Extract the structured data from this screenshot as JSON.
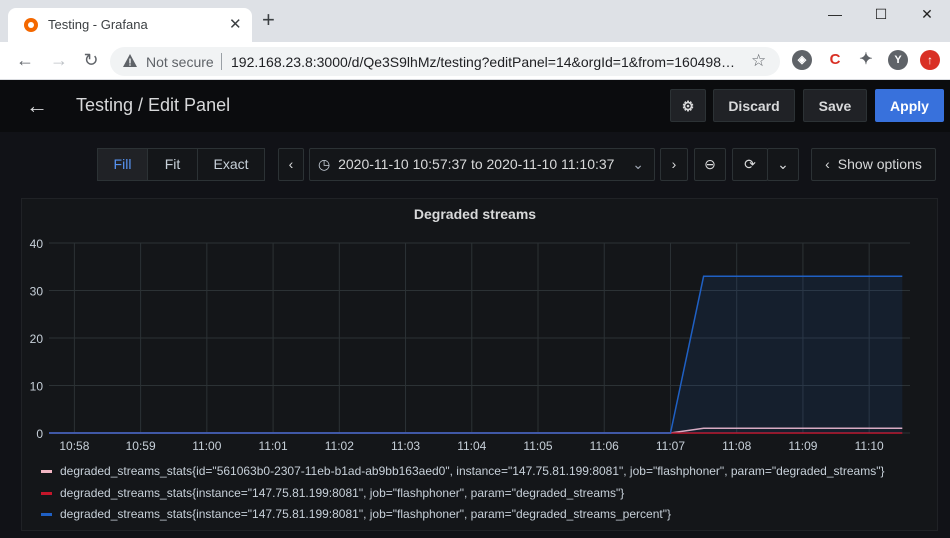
{
  "browser": {
    "tab_title": "Testing - Grafana",
    "security_label": "Not secure",
    "url": "192.168.23.8:3000/d/Qe3S9lhMz/testing?editPanel=14&orgId=1&from=160498…",
    "profile_initial": "Y"
  },
  "header": {
    "title": "Testing / Edit Panel",
    "discard_label": "Discard",
    "save_label": "Save",
    "apply_label": "Apply"
  },
  "toolbar": {
    "fill_label": "Fill",
    "fit_label": "Fit",
    "exact_label": "Exact",
    "time_range": "2020-11-10 10:57:37 to 2020-11-10 11:10:37",
    "show_options_label": "Show options"
  },
  "panel": {
    "title": "Degraded streams"
  },
  "chart_data": {
    "type": "line",
    "title": "Degraded streams",
    "x_ticks": [
      "10:58",
      "10:59",
      "11:00",
      "11:01",
      "11:02",
      "11:03",
      "11:04",
      "11:05",
      "11:06",
      "11:07",
      "11:08",
      "11:09",
      "11:10"
    ],
    "y_ticks": [
      0,
      10,
      20,
      30,
      40
    ],
    "ylim": [
      0,
      40
    ],
    "xlim": [
      "10:57:37",
      "11:10:37"
    ],
    "grid": true,
    "legend_placement": "bottom",
    "series": [
      {
        "name": "degraded_streams_stats{id=\"561063b0-2307-11eb-b1ad-ab9bb163aed0\", instance=\"147.75.81.199:8081\", job=\"flashphoner\", param=\"degraded_streams\"}",
        "color": "#f2b6c3",
        "points": [
          [
            "10:57:37",
            0
          ],
          [
            "11:07:00",
            0
          ],
          [
            "11:07:30",
            1
          ],
          [
            "11:10:30",
            1
          ]
        ]
      },
      {
        "name": "degraded_streams_stats{instance=\"147.75.81.199:8081\", job=\"flashphoner\", param=\"degraded_streams\"}",
        "color": "#c4162a",
        "points": [
          [
            "10:57:37",
            0
          ],
          [
            "11:10:30",
            0
          ]
        ]
      },
      {
        "name": "degraded_streams_stats{instance=\"147.75.81.199:8081\", job=\"flashphoner\", param=\"degraded_streams_percent\"}",
        "color": "#1f60c4",
        "fill": true,
        "points": [
          [
            "10:57:37",
            0
          ],
          [
            "11:07:00",
            0
          ],
          [
            "11:07:30",
            33
          ],
          [
            "11:10:30",
            33
          ]
        ]
      }
    ]
  }
}
